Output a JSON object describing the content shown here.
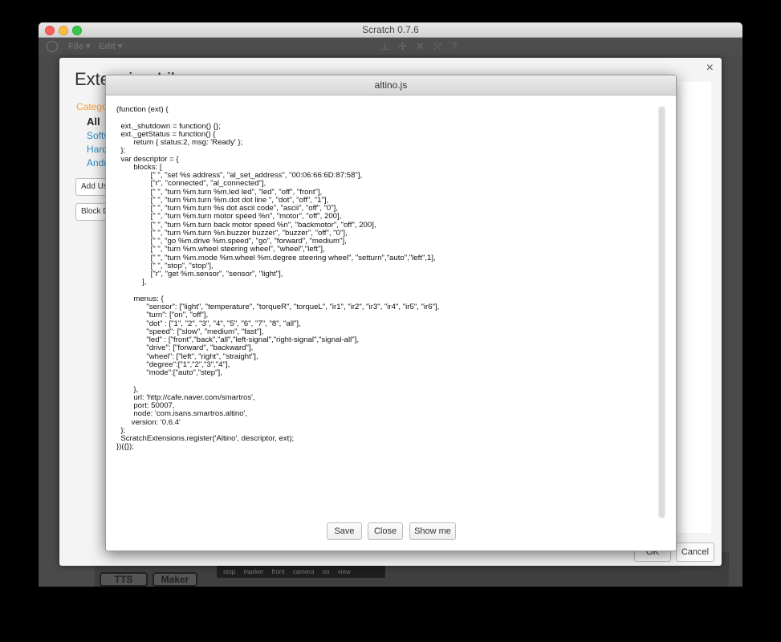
{
  "window": {
    "title": "Scratch 0.7.6"
  },
  "menubar": {
    "file": "File ▾",
    "edit": "Edit ▾"
  },
  "library": {
    "title": "Extension Library",
    "category_header": "Category",
    "categories": [
      "All",
      "Software",
      "Hardware",
      "Android"
    ],
    "add_button": "Add User Extension",
    "block_button": "Block Descriptor",
    "ok": "OK",
    "cancel": "Cancel",
    "close": "×"
  },
  "backdrop": {
    "tts": "TTS",
    "maker": "Maker",
    "sensor_labels": [
      "stop",
      "marker",
      "front",
      "camera",
      "on",
      "view"
    ]
  },
  "editor": {
    "title": "altino.js",
    "code": "(function (ext) {\n\n  ext._shutdown = function() {};\n  ext._getStatus = function() {\n        return { status:2, msg: 'Ready' };\n  };\n  var descriptor = {\n        blocks: [\n                [\" \", \"set %s address\", \"al_set_address\", \"00:06:66:6D:87:58\"],\n                [\"r\", \"connected\", \"al_connected\"],\n                [\" \", \"turn %m.turn %m.led led\", \"led\", \"off\", \"front\"],\n                [\" \", \"turn %m.turn %m.dot dot line \", \"dot\", \"off\", \"1\"],\n                [\" \", \"turn %m.turn %s dot ascii code\", \"ascii\", \"off\", \"0\"],\n                [\" \", \"turn %m.turn motor speed %n\", \"motor\", \"off\", 200],\n                [\" \", \"turn %m.turn back motor speed %n\", \"backmotor\", \"off\", 200],\n                [\" \", \"turn %m.turn %n.buzzer buzzer\", \"buzzer\", \"off\", \"0\"],\n                [\" \", \"go %m.drive %m.speed\", \"go\", \"forward\", \"medium\"],\n                [\" \", \"turn %m.wheel steering wheel\", \"wheel\",\"left\"],\n                [\" \", \"turn %m.mode %m.wheel %m.degree steering wheel\", \"setturn\",\"auto\",\"left\",1],\n                [\" \", \"stop\", \"stop\"],\n                [\"r\", \"get %m.sensor\", \"sensor\", \"light\"],\n            ],\n\n        menus: {\n              \"sensor\": [\"light\", \"temperature\", \"torqueR\", \"torqueL\", \"ir1\", \"ir2\", \"ir3\", \"ir4\", \"ir5\", \"ir6\"],\n              \"turn\": [\"on\", \"off\"],\n              \"dot\" : [\"1\", \"2\", \"3\", \"4\", \"5\", \"6\", \"7\", \"8\", \"all\"],\n              \"speed\": [\"slow\", \"medium\", \"fast\"],\n              \"led\" : [\"front\",\"back\",\"all\",\"left-signal\",\"right-signal\",\"signal-all\"],\n              \"drive\": [\"forward\", \"backward\"],\n              \"wheel\": [\"left\", \"right\", \"straight\"],\n              \"degree\":[\"1\",\"2\",\"3\",\"4\"],\n              \"mode\":[\"auto\",\"step\"],\n\n        },\n        url: 'http://cafe.naver.com/smartros',\n        port: 50007,\n        node: 'com.isans.smartros.altino',\n       version: '0.6.4'\n  };\n  ScratchExtensions.register('Altino', descriptor, ext);\n})({});",
    "buttons": {
      "save": "Save",
      "close": "Close",
      "show_me": "Show me"
    }
  }
}
